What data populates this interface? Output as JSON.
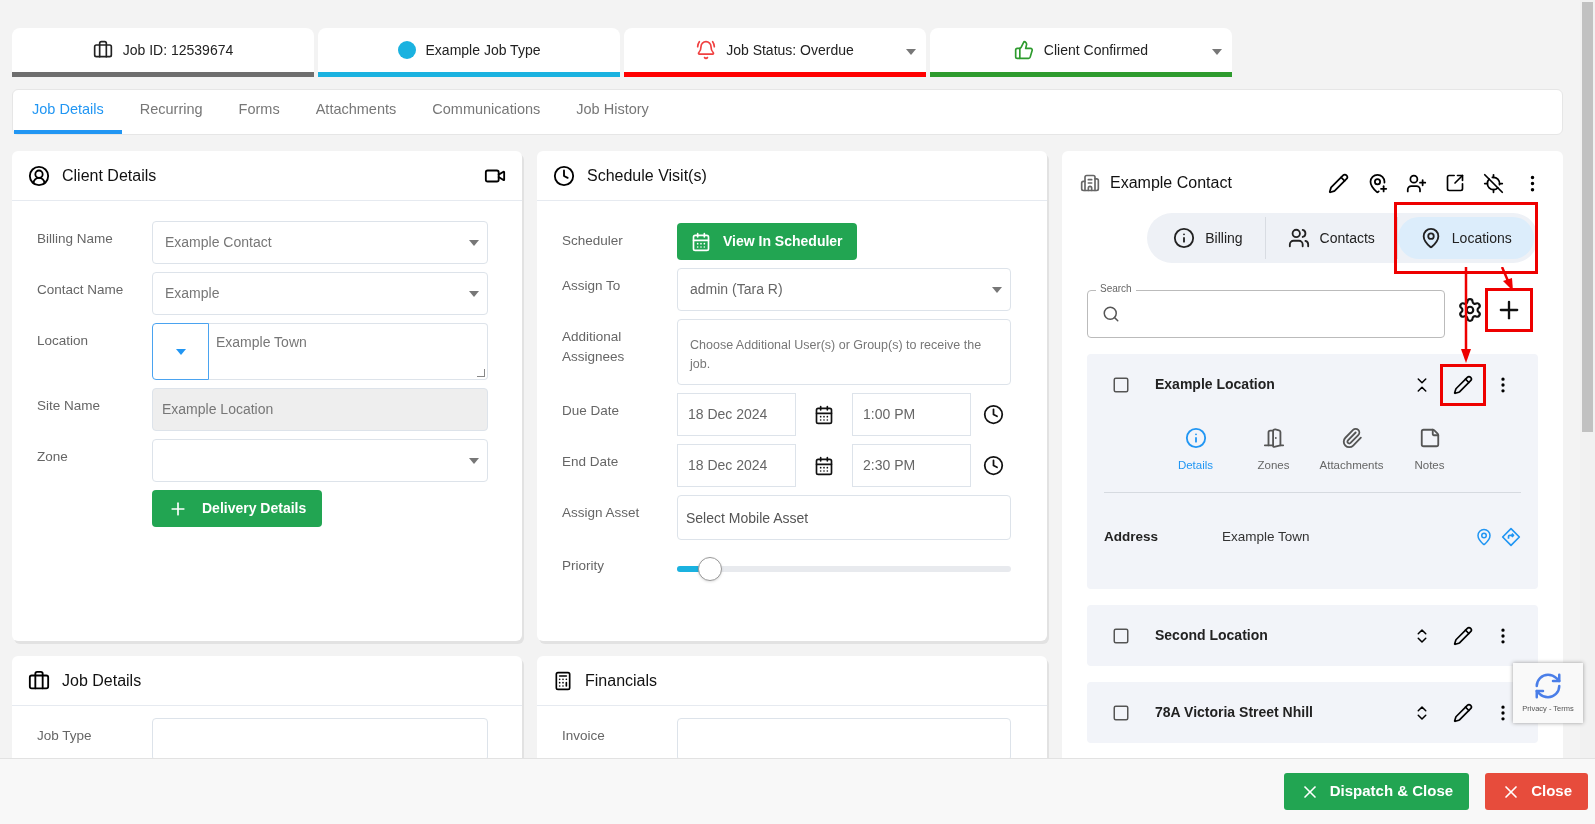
{
  "status_cards": [
    {
      "kind": "job_id",
      "label": "Job ID: 12539674",
      "color": "#6e6e6e",
      "dropdown": false
    },
    {
      "kind": "job_type",
      "label": "Example Job Type",
      "color": "#1ab2e0",
      "dropdown": false
    },
    {
      "kind": "status",
      "label": "Job Status: Overdue",
      "color": "#ff0000",
      "dropdown": true
    },
    {
      "kind": "confirmed",
      "label": "Client Confirmed",
      "color": "#2e9b2e",
      "dropdown": true
    }
  ],
  "tabs": [
    {
      "label": "Job Details",
      "selected": true
    },
    {
      "label": "Recurring",
      "selected": false
    },
    {
      "label": "Forms",
      "selected": false
    },
    {
      "label": "Attachments",
      "selected": false
    },
    {
      "label": "Communications",
      "selected": false
    },
    {
      "label": "Job History",
      "selected": false
    }
  ],
  "client_details": {
    "title": "Client Details",
    "fields": [
      {
        "kind": "select",
        "label": "Billing Name",
        "value": "Example Contact"
      },
      {
        "kind": "select",
        "label": "Contact Name",
        "value": "Example"
      },
      {
        "kind": "location",
        "label": "Location",
        "value": "Example Town"
      },
      {
        "kind": "readonly",
        "label": "Site Name",
        "value": "Example Location"
      },
      {
        "kind": "select",
        "label": "Zone"
      }
    ],
    "button": "Delivery Details"
  },
  "job_details": {
    "title": "Job Details",
    "fields": [
      {
        "label": "Job Type"
      }
    ]
  },
  "schedule": {
    "title": "Schedule Visit(s)",
    "scheduler_label": "Scheduler",
    "scheduler_button": "View In Scheduler",
    "assign_to": {
      "label": "Assign To",
      "value": "admin (Tara R)"
    },
    "additional": {
      "label": "Additional Assignees",
      "placeholder": "Choose Additional User(s) or Group(s) to receive the job."
    },
    "dates": [
      {
        "label": "Due Date",
        "date": "18 Dec 2024",
        "time": "1:00 PM"
      },
      {
        "label": "End Date",
        "date": "18 Dec 2024",
        "time": "2:30 PM"
      }
    ],
    "asset": {
      "label": "Assign Asset",
      "placeholder": "Select Mobile Asset"
    },
    "priority": {
      "label": "Priority",
      "level": 0.1
    }
  },
  "financials": {
    "title": "Financials",
    "fields": [
      {
        "label": "Invoice"
      }
    ]
  },
  "contact": {
    "name": "Example Contact",
    "tabs": [
      {
        "kind": "info",
        "label": "Billing",
        "selected": false
      },
      {
        "kind": "people",
        "label": "Contacts",
        "selected": false
      },
      {
        "kind": "pin",
        "label": "Locations",
        "selected": true
      }
    ],
    "search": {
      "label": "Search"
    },
    "locations": [
      {
        "name": "Example Location",
        "checked": false,
        "expanded": true,
        "subtabs": [
          {
            "kind": "info",
            "label": "Details",
            "selected": true
          },
          {
            "kind": "door",
            "label": "Zones",
            "selected": false
          },
          {
            "kind": "clip",
            "label": "Attachments",
            "selected": false
          },
          {
            "kind": "note",
            "label": "Notes",
            "selected": false
          }
        ],
        "address_label": "Address",
        "address": "Example Town"
      },
      {
        "name": "Second Location",
        "checked": false,
        "expanded": false
      },
      {
        "name": "78A Victoria Street Nhill",
        "checked": false,
        "expanded": false
      }
    ]
  },
  "recaptcha": {
    "text": "Privacy - Terms"
  },
  "footer_buttons": [
    {
      "kind": "dispatch",
      "label": "Dispatch & Close"
    },
    {
      "kind": "close",
      "label": "Close"
    }
  ]
}
